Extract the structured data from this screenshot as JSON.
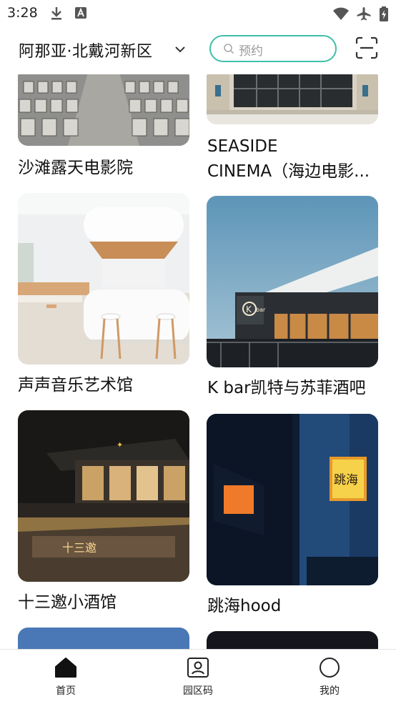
{
  "status_bar": {
    "time": "3:28"
  },
  "header": {
    "location": "阿那亚·北戴河新区",
    "search_placeholder": "预约"
  },
  "cards": [
    {
      "title": "沙滩露天电影院"
    },
    {
      "title": "SEASIDE"
    },
    {
      "title": "CINEMA（海边电影..."
    },
    {
      "title": "声声音乐艺术馆"
    },
    {
      "title": "K bar凯特与苏菲酒吧"
    },
    {
      "title": "十三邀小酒馆"
    },
    {
      "title": "跳海hood"
    }
  ],
  "image_text": {
    "kbar_sign": "bar",
    "jump_sea_sign": "跳海",
    "thirteen_sign": "十三邀"
  },
  "bottom_nav": [
    {
      "label": "首页"
    },
    {
      "label": "园区码"
    },
    {
      "label": "我的"
    }
  ],
  "colors": {
    "accent": "#3fbfab",
    "text": "#111111",
    "background": "#ffffff"
  }
}
